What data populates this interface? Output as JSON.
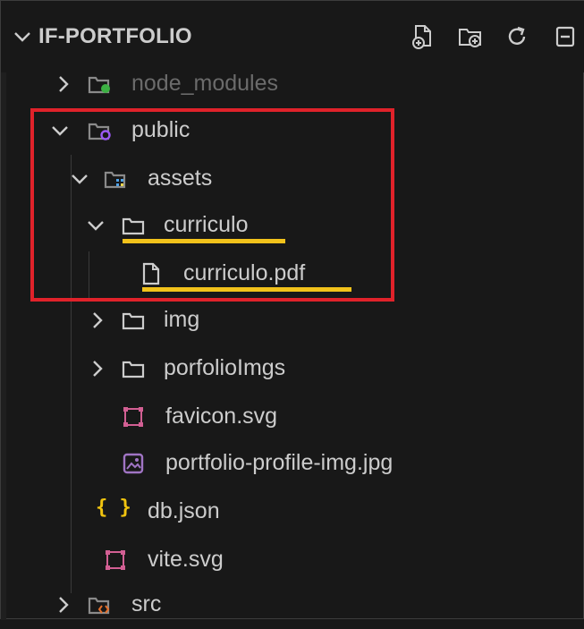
{
  "explorer": {
    "title": "IF-PORTFOLIO",
    "actions": [
      "new-file-icon",
      "new-folder-icon",
      "refresh-icon",
      "collapse-all-icon"
    ]
  },
  "tree": {
    "node_modules": "node_modules",
    "public": "public",
    "assets": "assets",
    "curriculo_folder": "curriculo",
    "curriculo_pdf": "curriculo.pdf",
    "img": "img",
    "porfolioImgs": "porfolioImgs",
    "favicon": "favicon.svg",
    "profile_img": "portfolio-profile-img.jpg",
    "db_json": "db.json",
    "vite_svg": "vite.svg",
    "src": "src"
  },
  "colors": {
    "background": "#181818",
    "text": "#cccccc",
    "dim_text": "#6b6b6b",
    "highlight_box": "#e0222a",
    "underline": "#f2c21b",
    "json_brace": "#f1c40f",
    "svg_icon": "#d25f93",
    "image_icon": "#a074c4"
  }
}
